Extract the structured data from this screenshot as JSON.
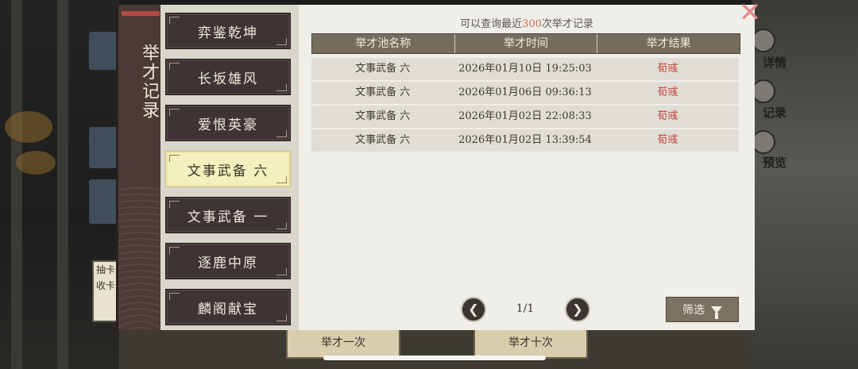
{
  "background": {
    "side_labels": [
      "详情",
      "记录",
      "预览"
    ],
    "left_knob_text": "抽卡收卡",
    "tab_texts": [
      "举才一次",
      "举才十次"
    ]
  },
  "dialog": {
    "title": "举才记录",
    "nav_items": [
      {
        "label": "弈鉴乾坤",
        "active": false
      },
      {
        "label": "长坂雄风",
        "active": false
      },
      {
        "label": "爱恨英豪",
        "active": false
      },
      {
        "label": "文事武备 六",
        "active": true
      },
      {
        "label": "文事武备 一",
        "active": false
      },
      {
        "label": "逐鹿中原",
        "active": false
      },
      {
        "label": "麟阁献宝",
        "active": false
      }
    ],
    "notice_prefix": "可以查询最近",
    "notice_count": "300",
    "notice_suffix": "次举才记录",
    "table": {
      "headers": [
        "举才池名称",
        "举才时间",
        "举才结果"
      ],
      "rows": [
        {
          "pool": "文事武备 六",
          "time": "2026年01月10日 19:25:03",
          "result": "荀彧"
        },
        {
          "pool": "文事武备 六",
          "time": "2026年01月06日 09:36:13",
          "result": "荀彧"
        },
        {
          "pool": "文事武备 六",
          "time": "2026年01月02日 22:08:33",
          "result": "荀彧"
        },
        {
          "pool": "文事武备 六",
          "time": "2026年01月02日 13:39:54",
          "result": "荀彧"
        }
      ]
    },
    "pagination": {
      "text": "1/1",
      "prev_icon": "arrow-left-icon",
      "next_icon": "arrow-right-icon"
    },
    "filter_label": "筛选",
    "filter_icon": "funnel-icon",
    "close_icon": "close-icon"
  },
  "colors": {
    "accent_number": "#d0694e",
    "result_red": "#c8443c",
    "active_nav": "#f4efbe",
    "nav_dark": "#3e3434"
  }
}
